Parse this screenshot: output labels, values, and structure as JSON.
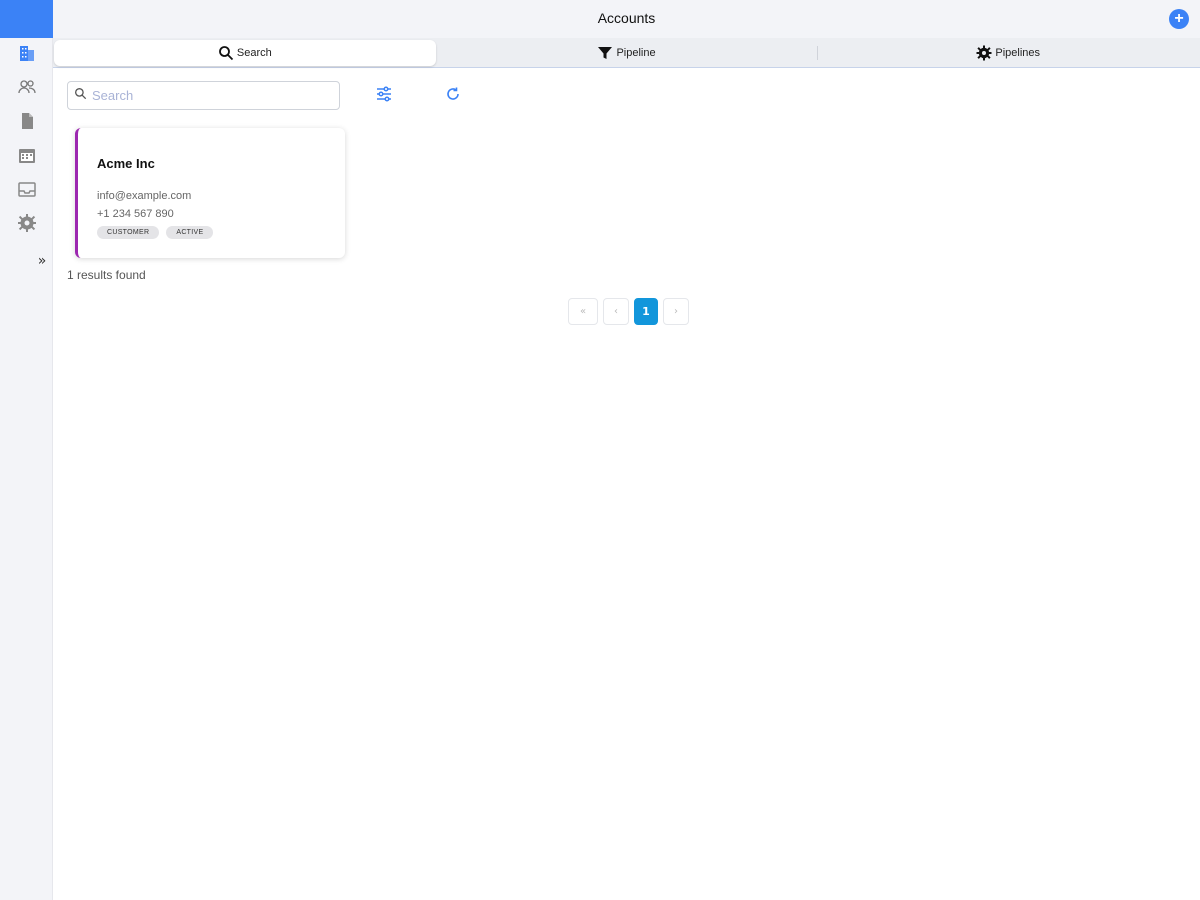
{
  "header": {
    "title": "Accounts",
    "add_label": "+"
  },
  "tabs": [
    {
      "label": "Search",
      "icon": "search-icon",
      "active": true
    },
    {
      "label": "Pipeline",
      "icon": "filter-icon",
      "active": false
    },
    {
      "label": "Pipelines",
      "icon": "gear-icon",
      "active": false
    }
  ],
  "sidebar": {
    "items": [
      {
        "icon": "building-icon",
        "active": true
      },
      {
        "icon": "users-icon",
        "active": false
      },
      {
        "icon": "document-icon",
        "active": false
      },
      {
        "icon": "calendar-icon",
        "active": false
      },
      {
        "icon": "inbox-icon",
        "active": false
      },
      {
        "icon": "gear-icon",
        "active": false
      }
    ],
    "expand_label": "»"
  },
  "search": {
    "placeholder": "Search",
    "value": ""
  },
  "toolbar": {
    "filter_icon": "sliders-icon",
    "refresh_icon": "refresh-icon"
  },
  "results": {
    "cards": [
      {
        "name": "Acme Inc",
        "email": "info@example.com",
        "phone": "+1 234 567 890",
        "badges": [
          "CUSTOMER",
          "ACTIVE"
        ]
      }
    ],
    "summary": "1 results found"
  },
  "pagination": {
    "first": "«",
    "prev": "‹",
    "current": "1",
    "next": "›"
  },
  "colors": {
    "accent": "#3b82f6",
    "card_border": "#9c27b0",
    "page_active": "#1296db"
  }
}
